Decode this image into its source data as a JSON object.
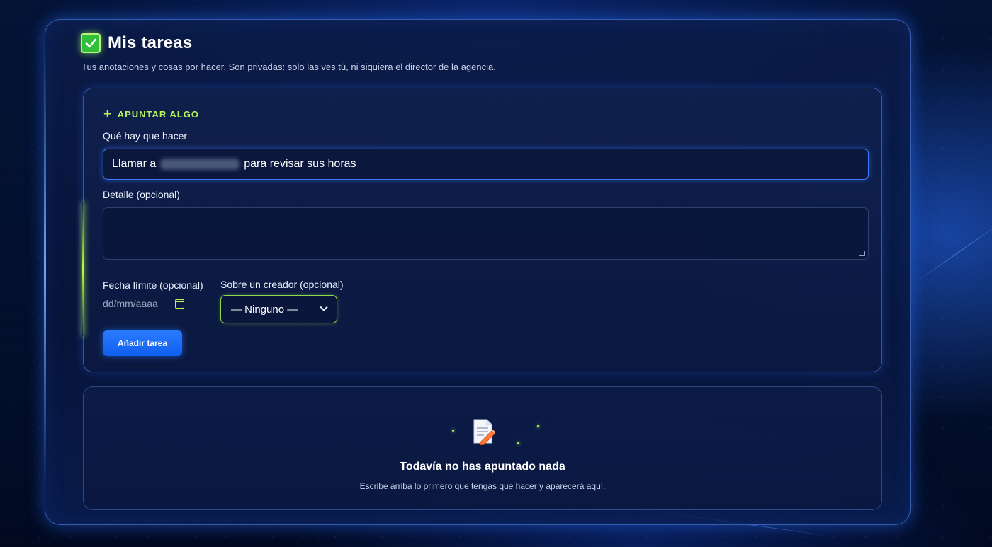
{
  "header": {
    "title": "Mis tareas",
    "subtitle": "Tus anotaciones y cosas por hacer. Son privadas: solo las ves tú, ni siquiera el director de la agencia.",
    "icon": "checkbox-icon"
  },
  "form": {
    "section_label": "APUNTAR ALGO",
    "task_label": "Qué hay que hacer",
    "task_value_prefix": "Llamar a",
    "task_value_suffix": "para revisar sus horas",
    "detail_label": "Detalle (opcional)",
    "detail_value": "",
    "date_label": "Fecha límite (opcional)",
    "date_placeholder": "dd/mm/aaaa",
    "creator_label": "Sobre un creador (opcional)",
    "creator_selected": "— Ninguno —",
    "submit_label": "Añadir tarea"
  },
  "empty_state": {
    "title": "Todavía no has apuntado nada",
    "text": "Escribe arriba lo primero que tengas que hacer y aparecerá aquí.",
    "icon": "memo-pencil-icon"
  },
  "colors": {
    "accent_blue": "#2b7bff",
    "accent_green": "#b8f55a",
    "check_green": "#2fbf3a"
  }
}
